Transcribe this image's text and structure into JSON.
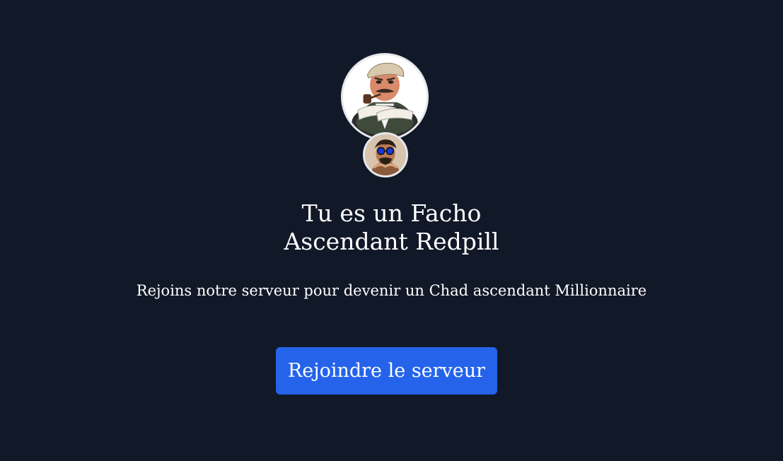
{
  "server": {
    "main_avatar_icon": "pipe-smoking-man-avatar-icon",
    "owner_avatar_icon": "sunglasses-man-avatar-icon"
  },
  "invite": {
    "title_line1": "Tu es un Facho",
    "title_line2": "Ascendant Redpill",
    "description": "Rejoins notre serveur pour devenir un Chad ascendant Millionnaire",
    "join_button_label": "Rejoindre le serveur"
  },
  "colors": {
    "background": "#111827",
    "button": "#2563eb",
    "text": "#ffffff"
  }
}
